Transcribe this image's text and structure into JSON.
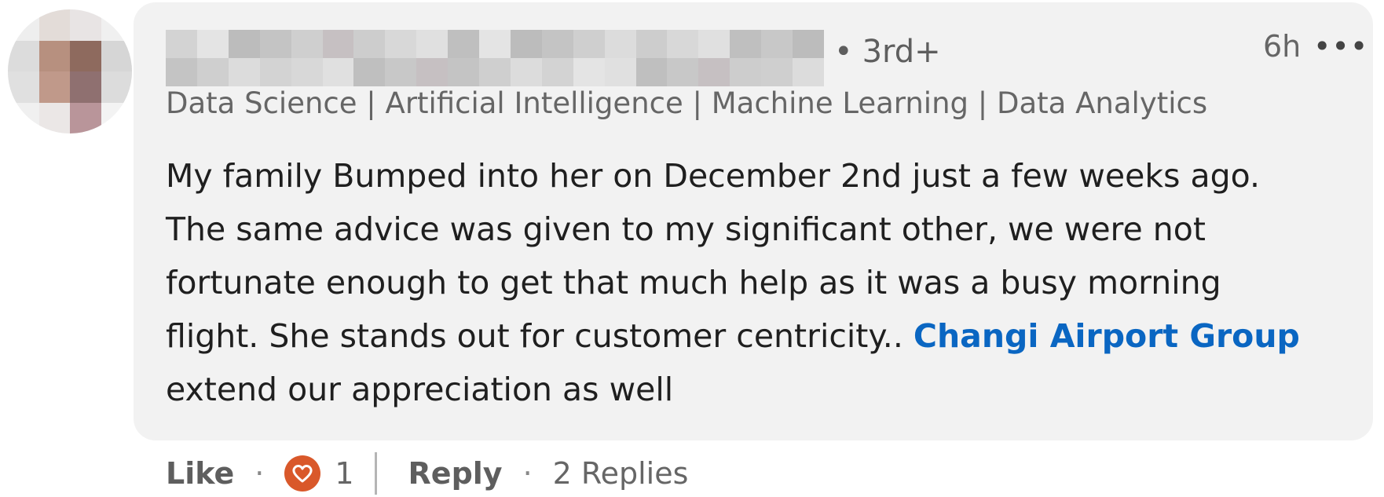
{
  "comment": {
    "author_name": "",
    "degree": "3rd+",
    "degree_dot": "•",
    "timestamp": "6h",
    "more_icon": "•••",
    "headline": "Data Science | Artificial Intelligence | Machine Learning | Data Analytics |...",
    "body_text": "My family Bumped into her on December 2nd just a few weeks ago. The same advice was given to my significant other, we were not fortunate enough to get that much help as it was a busy morning flight. She stands out for customer centricity.. ",
    "mention": "Changi Airport Group",
    "body_tail": " extend our appreciation as well"
  },
  "actions": {
    "like_label": "Like",
    "dot": "·",
    "reaction_icon": "heart-icon",
    "reaction_count": "1",
    "reply_label": "Reply",
    "replies_label": "2 Replies"
  },
  "colors": {
    "bubble_bg": "#f2f2f2",
    "mention": "#0a66c2",
    "reaction": "#d9582a"
  }
}
